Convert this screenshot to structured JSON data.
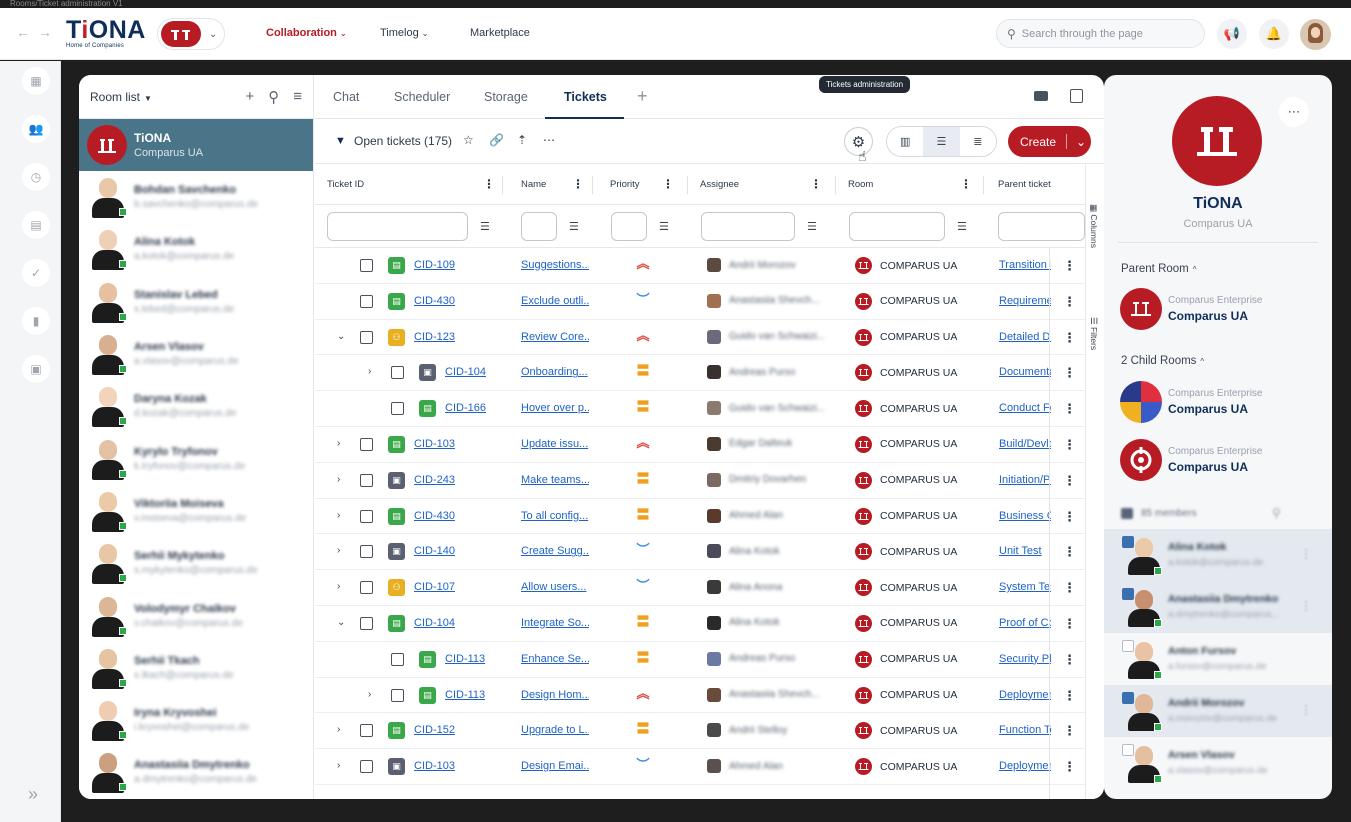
{
  "window": {
    "title": "Rooms/Ticket administration V1"
  },
  "header": {
    "logo_text": "TiONA",
    "logo_subtitle": "Home of Companies",
    "nav": [
      {
        "label": "Collaboration",
        "active": true
      },
      {
        "label": "Timelog",
        "active": false
      },
      {
        "label": "Marketplace",
        "active": false
      }
    ],
    "search": {
      "placeholder": "Search through the page"
    },
    "icons": [
      "back-arrow-icon",
      "forward-arrow-icon",
      "megaphone-icon",
      "bell-icon",
      "user-avatar"
    ]
  },
  "rail": {
    "icons": [
      "dashboard-icon",
      "rooms-icon",
      "timelog-icon",
      "calendar-icon",
      "tasks-icon",
      "files-icon",
      "marketplace-icon"
    ],
    "expand": "»"
  },
  "room_list": {
    "title": "Room list",
    "selected": {
      "name": "TiONA",
      "subtitle": "Comparus UA"
    },
    "people": [
      {
        "name": "Bohdan Savchenko",
        "email": "b.savchenko@comparus.de"
      },
      {
        "name": "Alina Kotok",
        "email": "a.kotok@comparus.de"
      },
      {
        "name": "Stanislav Lebed",
        "email": "s.lebed@comparus.de"
      },
      {
        "name": "Arsen Vlasov",
        "email": "a.vlasov@comparus.de"
      },
      {
        "name": "Daryna Kozak",
        "email": "d.kozak@comparus.de"
      },
      {
        "name": "Kyrylo Tryfonov",
        "email": "k.tryfonov@comparus.de"
      },
      {
        "name": "Viktoriia Moiseva",
        "email": "v.moiseva@comparus.de"
      },
      {
        "name": "Serhii Mykytenko",
        "email": "s.mykytenko@comparus.de"
      },
      {
        "name": "Volodymyr Chaikov",
        "email": "v.chaikov@comparus.de"
      },
      {
        "name": "Serhii Tkach",
        "email": "s.tkach@comparus.de"
      },
      {
        "name": "Iryna Kryvoshei",
        "email": "i.kryvoshei@comparus.de"
      },
      {
        "name": "Anastasiia Dmytrenko",
        "email": "a.dmytrenko@comparus.de"
      }
    ]
  },
  "tabs": [
    {
      "label": "Chat",
      "active": false
    },
    {
      "label": "Scheduler",
      "active": false
    },
    {
      "label": "Storage",
      "active": false
    },
    {
      "label": "Tickets",
      "active": true
    }
  ],
  "toolbar": {
    "open_tickets_label": "Open tickets (175)",
    "tooltip": "Tickets administration",
    "create_label": "Create"
  },
  "table": {
    "columns": [
      "Ticket ID",
      "Name",
      "Priority",
      "Assignee",
      "Room",
      "Parent ticket"
    ],
    "side_labels": [
      "Columns",
      "Filters"
    ],
    "rows": [
      {
        "id": "CID-109",
        "name": "Suggestions...",
        "priority": "high",
        "assignee": "Andrii Morozov",
        "room": "COMPARUS UA",
        "parent": "Transition Pl",
        "type": "story",
        "indent": 0,
        "expander": ""
      },
      {
        "id": "CID-430",
        "name": "Exclude outli...",
        "priority": "low",
        "assignee": "Anastasiia Shevch...",
        "room": "COMPARUS UA",
        "parent": "Requirements",
        "type": "story",
        "indent": 0,
        "expander": ""
      },
      {
        "id": "CID-123",
        "name": "Review Core...",
        "priority": "high",
        "assignee": "Guido van Schwaizi...",
        "room": "COMPARUS UA",
        "parent": "Detailed Desi",
        "type": "group",
        "indent": 0,
        "expander": "⌄"
      },
      {
        "id": "CID-104",
        "name": "Onboarding...",
        "priority": "medium",
        "assignee": "Andreas Purso",
        "room": "COMPARUS UA",
        "parent": "Documentatio",
        "type": "task",
        "indent": 1,
        "expander": "›"
      },
      {
        "id": "CID-166",
        "name": "Hover over p...",
        "priority": "medium",
        "assignee": "Guido van Schwaizi...",
        "room": "COMPARUS UA",
        "parent": "Conduct Feas",
        "type": "story",
        "indent": 1,
        "expander": ""
      },
      {
        "id": "CID-103",
        "name": "Update issu...",
        "priority": "high",
        "assignee": "Edgar Dalteuk",
        "room": "COMPARUS UA",
        "parent": "Build/Devlop",
        "type": "story",
        "indent": 0,
        "expander": "›"
      },
      {
        "id": "CID-243",
        "name": "Make teams...",
        "priority": "medium",
        "assignee": "Dmitriy Dovarhen",
        "room": "COMPARUS UA",
        "parent": "Initiation/Pla",
        "type": "task",
        "indent": 0,
        "expander": "›"
      },
      {
        "id": "CID-430",
        "name": "To all config...",
        "priority": "medium",
        "assignee": "Ahmed Alan",
        "room": "COMPARUS UA",
        "parent": "Business Cas",
        "type": "story",
        "indent": 0,
        "expander": "›"
      },
      {
        "id": "CID-140",
        "name": "Create Sugg...",
        "priority": "low",
        "assignee": "Alina Kotok",
        "room": "COMPARUS UA",
        "parent": "Unit Test",
        "type": "task",
        "indent": 0,
        "expander": "›"
      },
      {
        "id": "CID-107",
        "name": "Allow users...",
        "priority": "low",
        "assignee": "Alina Anona",
        "room": "COMPARUS UA",
        "parent": "System Testin",
        "type": "group",
        "indent": 0,
        "expander": "›"
      },
      {
        "id": "CID-104",
        "name": "Integrate So...",
        "priority": "medium",
        "assignee": "Alina Kotok",
        "room": "COMPARUS UA",
        "parent": "Proof of Cond",
        "type": "story",
        "indent": 0,
        "expander": "⌄"
      },
      {
        "id": "CID-113",
        "name": "Enhance Se...",
        "priority": "medium",
        "assignee": "Andreas Purso",
        "room": "COMPARUS UA",
        "parent": "Security Plan",
        "type": "story",
        "indent": 1,
        "expander": ""
      },
      {
        "id": "CID-113",
        "name": "Design Hom...",
        "priority": "high",
        "assignee": "Anastasiia Shevch...",
        "room": "COMPARUS UA",
        "parent": "Deployment",
        "type": "story",
        "indent": 1,
        "expander": "›"
      },
      {
        "id": "CID-152",
        "name": "Upgrade to L...",
        "priority": "medium",
        "assignee": "Andrii Stelloy",
        "room": "COMPARUS UA",
        "parent": "Function Test",
        "type": "story",
        "indent": 0,
        "expander": "›"
      },
      {
        "id": "CID-103",
        "name": "Design Emai...",
        "priority": "low",
        "assignee": "Ahmed Alan",
        "room": "COMPARUS UA",
        "parent": "Deployment",
        "type": "task",
        "indent": 0,
        "expander": "›"
      }
    ]
  },
  "room_panel": {
    "name": "TiONA",
    "subtitle": "Comparus UA",
    "parent_room_label": "Parent Room",
    "parent_room": {
      "enterprise": "Comparus Enterprise",
      "name": "Comparus UA"
    },
    "child_rooms_label": "2 Child Rooms",
    "child_rooms": [
      {
        "enterprise": "Comparus Enterprise",
        "name": "Comparus UA"
      },
      {
        "enterprise": "Comparus Enterprise",
        "name": "Comparus UA"
      }
    ],
    "members_label": "85 members",
    "members": [
      {
        "name": "Alina Kotok",
        "email": "a.kotok@comparus.de",
        "selected": true
      },
      {
        "name": "Anastasiia Dmytrenko",
        "email": "a.dmytrenko@comparus...",
        "selected": true
      },
      {
        "name": "Anton Fursov",
        "email": "a.fursov@comparus.de",
        "selected": false
      },
      {
        "name": "Andrii Morozov",
        "email": "a.morozov@comparus.de",
        "selected": true
      },
      {
        "name": "Arsen Vlasov",
        "email": "a.vlasov@comparus.de",
        "selected": false
      }
    ]
  },
  "colors": {
    "brand_red": "#b71c24",
    "navy": "#0f2f5a",
    "link_blue": "#1e62c8",
    "selected_room_bg": "#4a7588"
  }
}
